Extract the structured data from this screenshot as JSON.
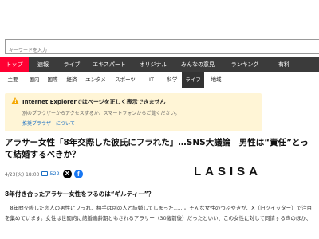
{
  "search": {
    "placeholder": "キーワードを入力"
  },
  "main_nav": [
    {
      "label": "トップ",
      "active": true
    },
    {
      "label": "速報"
    },
    {
      "label": "ライブ"
    },
    {
      "label": "エキスパート"
    },
    {
      "label": "オリジナル"
    },
    {
      "label": "みんなの意見"
    },
    {
      "label": "ランキング"
    },
    {
      "label": "有料"
    }
  ],
  "sub_nav": [
    {
      "label": "主要"
    },
    {
      "label": "国内"
    },
    {
      "label": "国際"
    },
    {
      "label": "経済"
    },
    {
      "label": "エンタメ"
    },
    {
      "label": "スポーツ"
    },
    {
      "label": "IT"
    },
    {
      "label": "科学"
    },
    {
      "label": "ライフ",
      "active": true
    },
    {
      "label": "地域"
    }
  ],
  "alert": {
    "icon": "warning-icon",
    "title": "Internet Explorerではページを正しく表示できません",
    "body": "別のブラウザーからアクセスするか、スマートフォンからご覧ください。",
    "link": "推奨ブラウザーについて"
  },
  "article": {
    "headline": "アラサー女性「8年交際した彼氏にフラれた」…SNS大議論　男性は“責任”とって結婚するべきか？",
    "date": "4/23(火) 18:03",
    "comment_count": "522",
    "brand": "LASISA",
    "section_heading": "8年付き合ったアラサー女性をフるのは“ギルティー”？",
    "body": "　8年間交際した恋人の男性にフラれ、相手は別の人と結婚してしまった……。そんな女性のつぶやきが、X（旧ツイッター）で注目を集めています。女性は世間的に結婚適齢期ともされるアラサー（30歳前後）だったといい、この女性に対して同情する声のほか、"
  },
  "colors": {
    "accent": "#ff0033",
    "nav_bg": "#3b3b3b",
    "alert_bg": "#fff5d6",
    "link": "#1a6fc4"
  }
}
